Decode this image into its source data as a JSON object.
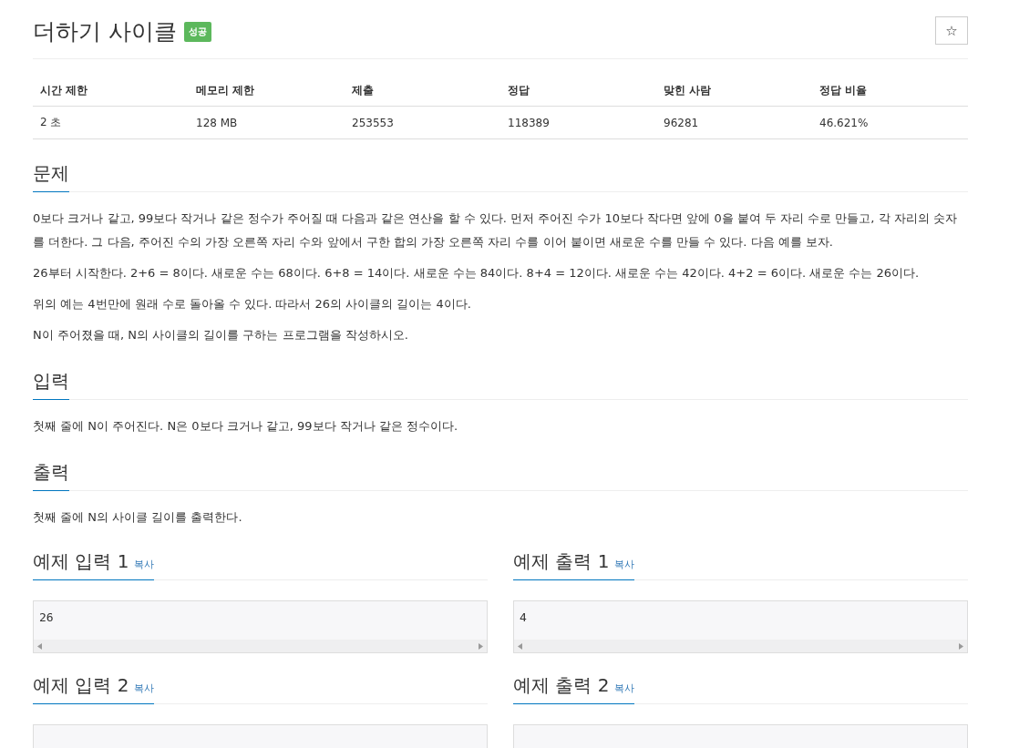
{
  "title": "더하기 사이클",
  "badge": "성공",
  "star_button": "☆",
  "info_table": {
    "columns": [
      "시간 제한",
      "메모리 제한",
      "제출",
      "정답",
      "맞힌 사람",
      "정답 비율"
    ],
    "rows": [
      [
        "2 초",
        "128 MB",
        "253553",
        "118389",
        "96281",
        "46.621%"
      ]
    ]
  },
  "sections": [
    {
      "heading": "문제",
      "paragraphs": [
        "0보다 크거나 같고, 99보다 작거나 같은 정수가 주어질 때 다음과 같은 연산을 할 수 있다. 먼저 주어진 수가 10보다 작다면 앞에 0을 붙여 두 자리 수로 만들고, 각 자리의 숫자를 더한다. 그 다음, 주어진 수의 가장 오른쪽 자리 수와 앞에서 구한 합의 가장 오른쪽 자리 수를 이어 붙이면 새로운 수를 만들 수 있다. 다음 예를 보자.",
        "26부터 시작한다. 2+6 = 8이다. 새로운 수는 68이다. 6+8 = 14이다. 새로운 수는 84이다. 8+4 = 12이다. 새로운 수는 42이다. 4+2 = 6이다. 새로운 수는 26이다.",
        "위의 예는 4번만에 원래 수로 돌아올 수 있다. 따라서 26의 사이클의 길이는 4이다.",
        "N이 주어졌을 때, N의 사이클의 길이를 구하는 프로그램을 작성하시오."
      ]
    },
    {
      "heading": "입력",
      "paragraphs": [
        "첫째 줄에 N이 주어진다. N은 0보다 크거나 같고, 99보다 작거나 같은 정수이다."
      ]
    },
    {
      "heading": "출력",
      "paragraphs": [
        "첫째 줄에 N의 사이클 길이를 출력한다."
      ]
    }
  ],
  "samples": [
    {
      "heading": "예제 입력 1",
      "copy": "복사",
      "value": "26"
    },
    {
      "heading": "예제 출력 1",
      "copy": "복사",
      "value": "4"
    },
    {
      "heading": "예제 입력 2",
      "copy": "복사"
    },
    {
      "heading": "예제 출력 2",
      "copy": "복사"
    }
  ]
}
